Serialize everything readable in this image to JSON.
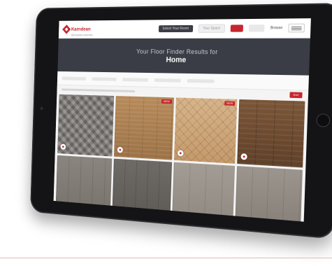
{
  "header": {
    "logo_text": "Karndean",
    "logo_subtext": "DESIGNFLOORING",
    "nav": [
      "Select Your Room",
      "Your Space",
      "Browse"
    ]
  },
  "hero": {
    "line1": "Your Floor Finder Results for",
    "line2": "Home"
  },
  "results": {
    "sort_label": "Sort"
  },
  "products": [
    {
      "swatch": "grey-herringbone",
      "badge": ""
    },
    {
      "swatch": "natural-oak",
      "badge": "NEW"
    },
    {
      "swatch": "light-herringbone",
      "badge": "NEW"
    },
    {
      "swatch": "walnut",
      "badge": ""
    },
    {
      "swatch": "grey-plank",
      "badge": ""
    },
    {
      "swatch": "dark-grey-plank",
      "badge": ""
    },
    {
      "swatch": "light-grey-plank",
      "badge": ""
    },
    {
      "swatch": "stone-grey-plank",
      "badge": ""
    }
  ],
  "colors": {
    "brand_red": "#c7262e",
    "hero_bg": "#3a3d45"
  }
}
